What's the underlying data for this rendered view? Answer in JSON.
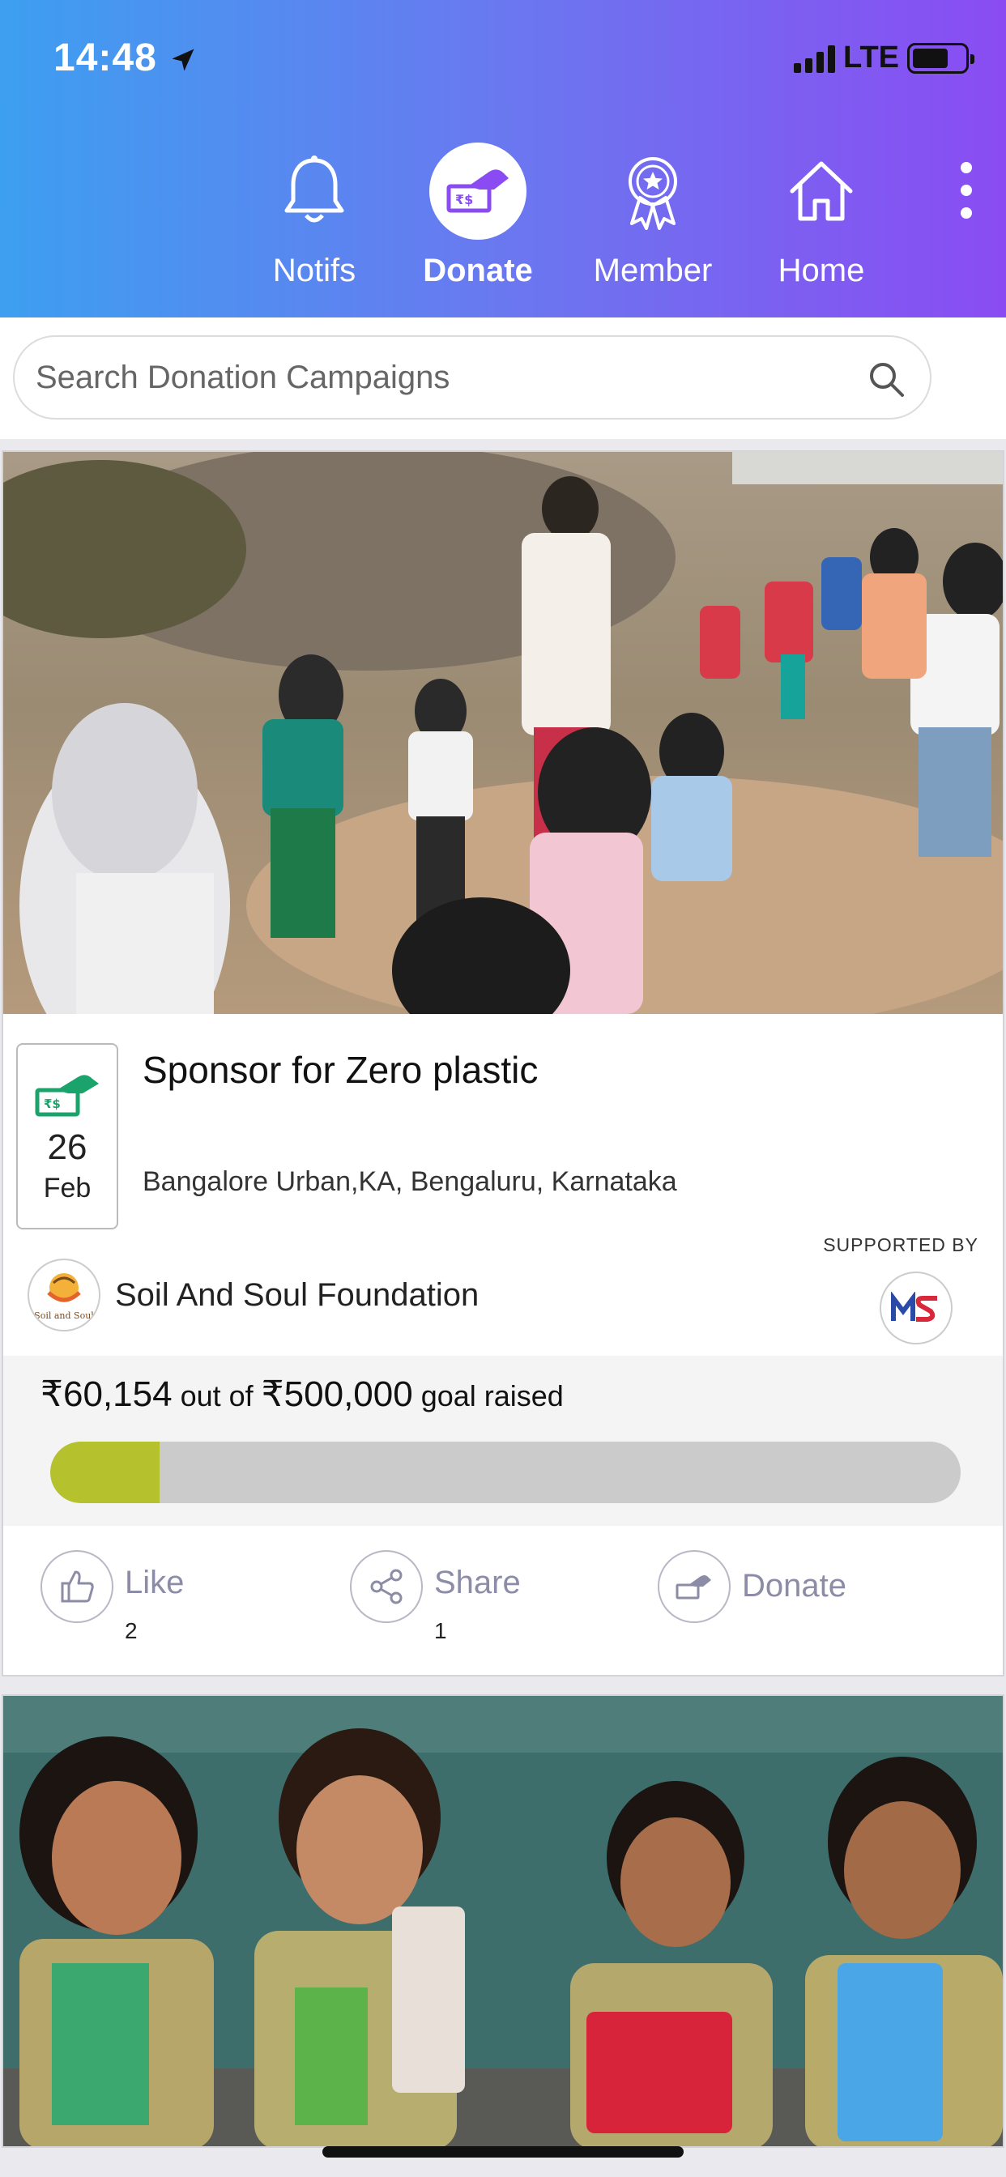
{
  "status_bar": {
    "time": "14:48",
    "network": "LTE"
  },
  "nav": {
    "items": [
      {
        "label": "Notifs",
        "icon": "bell-icon",
        "active": false
      },
      {
        "label": "Donate",
        "icon": "donate-hand-icon",
        "active": true
      },
      {
        "label": "Member",
        "icon": "member-badge-icon",
        "active": false
      },
      {
        "label": "Home",
        "icon": "home-icon",
        "active": false
      }
    ],
    "more_icon": "more-vertical-icon"
  },
  "search": {
    "placeholder": "Search Donation Campaigns",
    "value": ""
  },
  "campaigns": [
    {
      "title": "Sponsor for Zero plastic",
      "location": "Bangalore Urban,KA, Bengaluru, Karnataka",
      "date_day": "26",
      "date_month": "Feb",
      "organization": "Soil And Soul Foundation",
      "org_logo_text": "Soil and Soul",
      "supported_by_label": "SUPPORTED BY",
      "raised_amount": "₹60,154",
      "raised_middle": " out of ",
      "goal_amount": "₹500,000",
      "raised_suffix": " goal raised",
      "progress_fraction": 0.12,
      "actions": {
        "like_label": "Like",
        "like_count": "2",
        "share_label": "Share",
        "share_count": "1",
        "donate_label": "Donate"
      }
    }
  ],
  "colors": {
    "header_gradient_start": "#3d9ff0",
    "header_gradient_end": "#8a4cf2",
    "progress_fill": "#b5c22e",
    "progress_track": "#cbcbcb",
    "action_text": "#8c8ca6",
    "date_icon_green": "#1aa36a"
  }
}
